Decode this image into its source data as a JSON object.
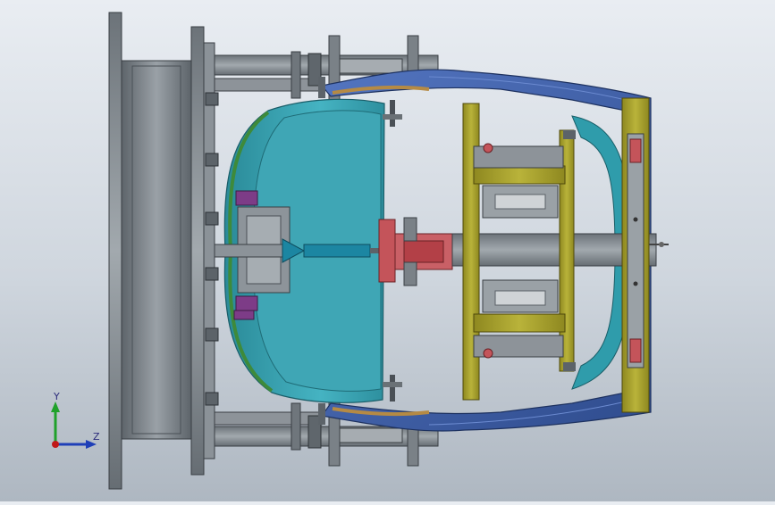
{
  "viewport": {
    "background_top": "#e9edf2",
    "background_bottom": "#aeb7c1"
  },
  "triad": {
    "y_label": "Y",
    "z_label": "Z",
    "y_color": "#1fa12a",
    "z_color": "#1f3fb8",
    "origin_color": "#c01818"
  },
  "colors": {
    "steel": "#7f868c",
    "steel_dark": "#4d5358",
    "body_blue": "#3d5fa8",
    "shell_teal": "#2e9aa8",
    "inner_teal": "#3aa3b4",
    "frame_olive": "#a7a02c",
    "clamp_red": "#c4545a",
    "rail_green": "#3e8a3a",
    "block_purple": "#7d3c87",
    "rod_cyan": "#1c86a2"
  }
}
